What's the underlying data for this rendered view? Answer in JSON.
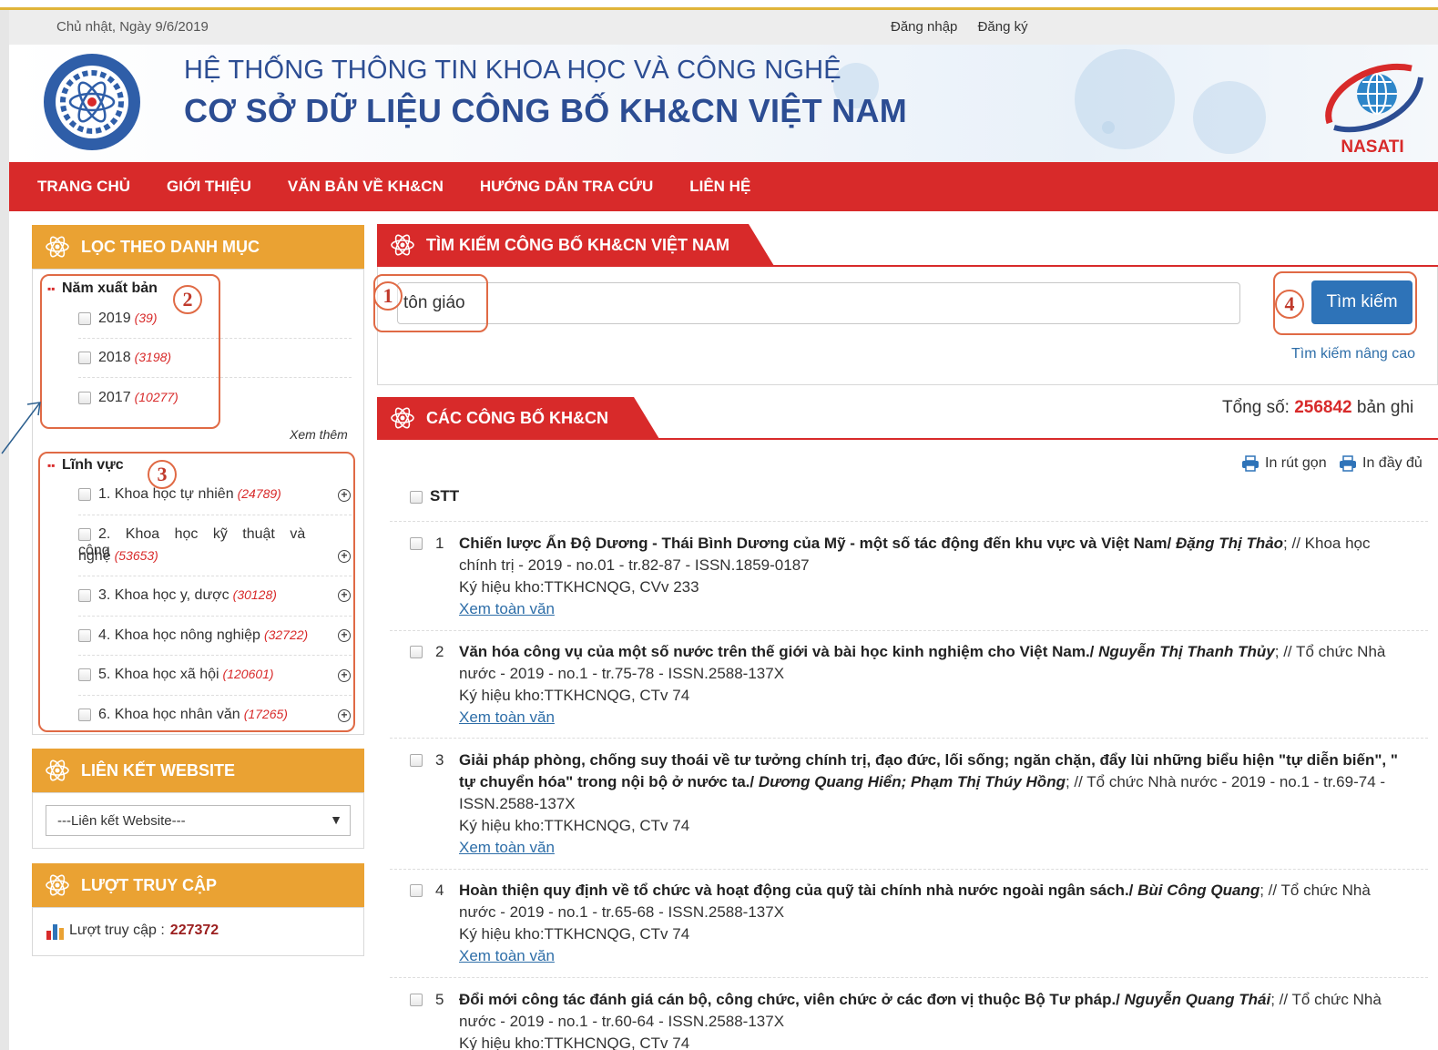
{
  "topbar": {
    "date": "Chủ nhật, Ngày 9/6/2019",
    "login": "Đăng nhập",
    "register": "Đăng ký"
  },
  "header": {
    "title_line1": "HỆ THỐNG THÔNG TIN KHOA HỌC VÀ CÔNG NGHỆ",
    "title_line2": "CƠ SỞ DỮ LIỆU CÔNG BỐ KH&CN VIỆT NAM",
    "right_logo_text": "NASATI"
  },
  "nav": {
    "items": [
      "TRANG CHỦ",
      "GIỚI THIỆU",
      "VĂN BẢN VỀ KH&CN",
      "HƯỚNG DẪN TRA CỨU",
      "LIÊN HỆ"
    ]
  },
  "filter": {
    "title": "LỌC THEO DANH MỤC",
    "year_section": {
      "title": "Năm xuất bản",
      "items": [
        {
          "label": "2019",
          "count": "(39)"
        },
        {
          "label": "2018",
          "count": "(3198)"
        },
        {
          "label": "2017",
          "count": "(10277)"
        }
      ],
      "more": "Xem thêm"
    },
    "field_section": {
      "title": "Lĩnh vực",
      "items": [
        {
          "label": "1. Khoa học tự nhiên",
          "count": "(24789)"
        },
        {
          "label_a": "2. Khoa học kỹ thuật và công",
          "label_b": "nghệ",
          "count": "(53653)"
        },
        {
          "label": "3. Khoa học y, dược",
          "count": "(30128)"
        },
        {
          "label": "4. Khoa học nông nghiệp",
          "count": "(32722)"
        },
        {
          "label": "5. Khoa học xã hội",
          "count": "(120601)"
        },
        {
          "label": "6. Khoa học nhân văn",
          "count": "(17265)"
        }
      ]
    }
  },
  "links": {
    "title": "LIÊN KẾT WEBSITE",
    "select_value": "---Liên kết Website---"
  },
  "visits": {
    "title": "LƯỢT TRUY CẬP",
    "label": "Lượt truy cập :",
    "value": "227372"
  },
  "search": {
    "title": "TÌM KIẾM CÔNG BỐ KH&CN VIỆT NAM",
    "query": "tôn giáo",
    "button": "Tìm kiếm",
    "advanced": "Tìm kiếm nâng cao"
  },
  "results": {
    "title": "CÁC CÔNG BỐ KH&CN",
    "total_label": "Tổng số:",
    "total_value": "256842",
    "total_unit": "bản ghi",
    "print_short": "In rút gọn",
    "print_full": "In đầy đủ",
    "stt_header": "STT",
    "link_text": "Xem toàn văn",
    "records": [
      {
        "num": "1",
        "title": "Chiến lược Ấn Độ Dương - Thái Bình Dương của Mỹ - một số tác động đến khu vực và Việt Nam/",
        "authors": "Đặng Thị Thảo",
        "source": "; // Khoa học chính trị - 2019 - no.01 - tr.82-87 - ISSN.1859-0187",
        "storage": "Ký hiệu kho:TTKHCNQG, CVv 233"
      },
      {
        "num": "2",
        "title": "Văn hóa công vụ của một số nước trên thế giới và bài học kinh nghiệm cho Việt Nam./",
        "authors": "Nguyễn Thị Thanh Thủy",
        "source": "; // Tổ chức Nhà nước - 2019 - no.1 - tr.75-78 - ISSN.2588-137X",
        "storage": "Ký hiệu kho:TTKHCNQG, CTv 74"
      },
      {
        "num": "3",
        "title": "Giải pháp phòng, chống suy thoái về tư tưởng chính trị, đạo đức, lối sống; ngăn chặn, đẩy lùi những biểu hiện \"tự diễn biến\", \" tự chuyển hóa\" trong nội bộ ở nước ta./",
        "authors": "Dương Quang Hiển; Phạm Thị Thúy Hồng",
        "source": "; // Tổ chức Nhà nước - 2019 - no.1 - tr.69-74 - ISSN.2588-137X",
        "storage": "Ký hiệu kho:TTKHCNQG, CTv 74"
      },
      {
        "num": "4",
        "title": "Hoàn thiện quy định về tổ chức và hoạt động của quỹ tài chính nhà nước ngoài ngân sách./",
        "authors": "Bùi Công Quang",
        "source": "; // Tổ chức Nhà nước - 2019 - no.1 - tr.65-68 - ISSN.2588-137X",
        "storage": "Ký hiệu kho:TTKHCNQG, CTv 74"
      },
      {
        "num": "5",
        "title": "Đổi mới công tác đánh giá cán bộ, công chức, viên chức ở các đơn vị thuộc Bộ Tư pháp./",
        "authors": "Nguyễn Quang Thái",
        "source": "; // Tổ chức Nhà nước - 2019 - no.1 - tr.60-64 - ISSN.2588-137X",
        "storage": "Ký hiệu kho:TTKHCNQG, CTv 74"
      }
    ]
  },
  "annotations": [
    "1",
    "2",
    "3",
    "4"
  ],
  "colors": {
    "nav_red": "#d82a2a",
    "panel_orange": "#eaa233",
    "title_blue": "#2c4d93",
    "button_blue": "#2e73b8",
    "annotation": "#e06a45"
  }
}
